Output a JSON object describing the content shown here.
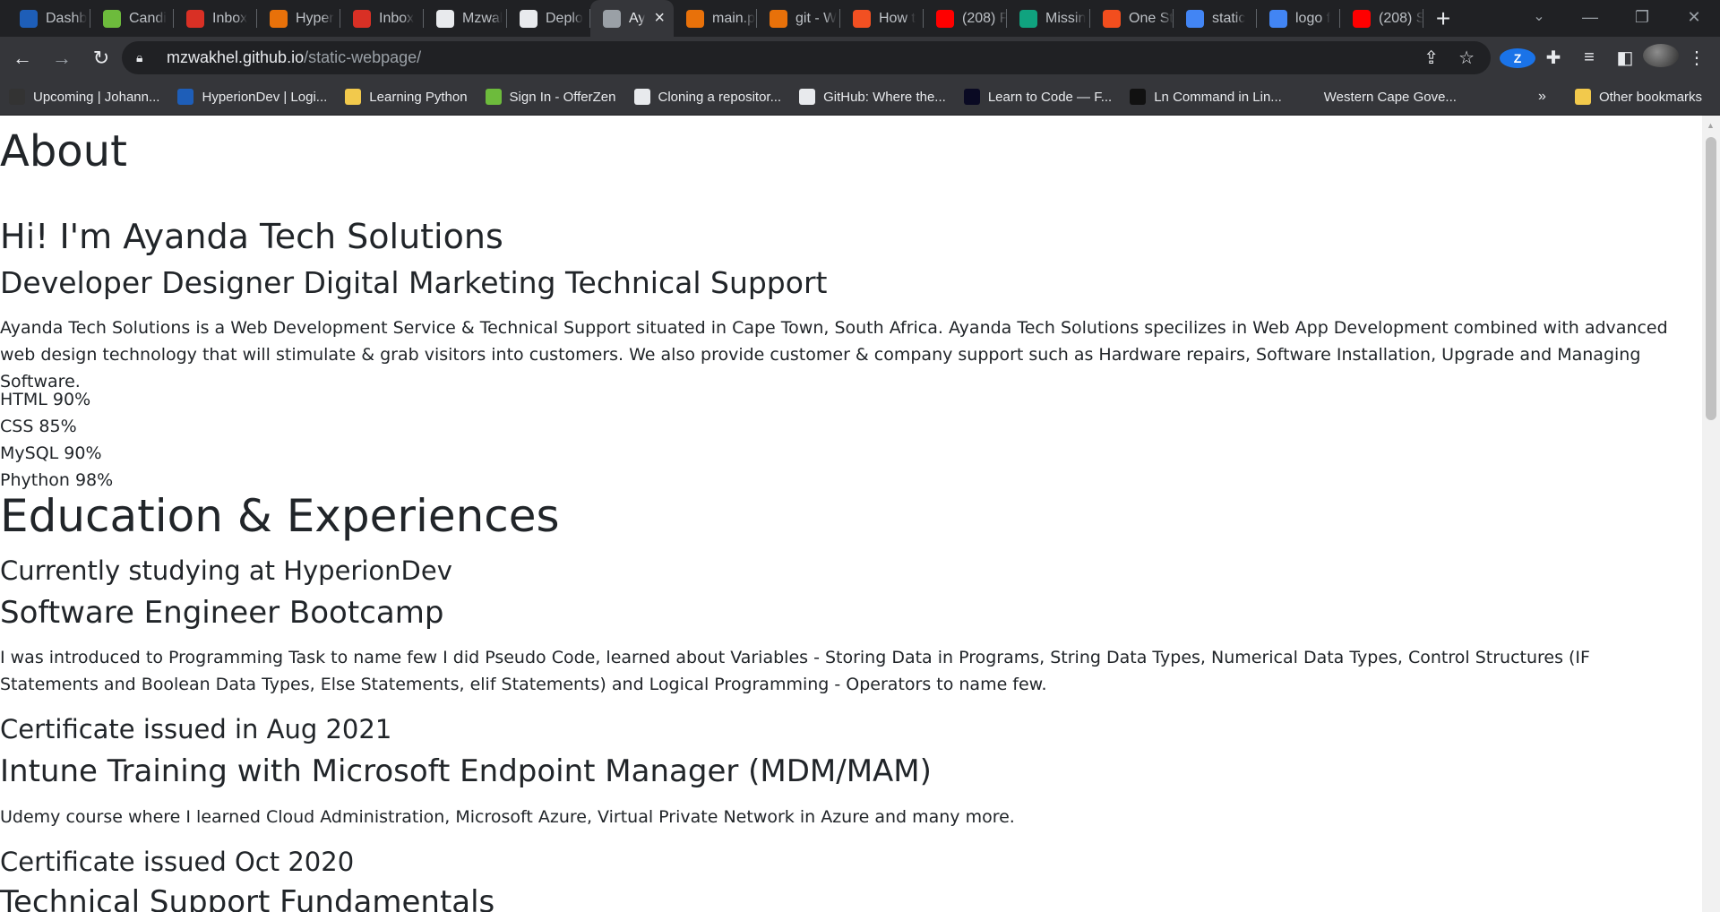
{
  "browser": {
    "tabs": [
      {
        "title": "Dashb",
        "icon": "hyperiondev-icon",
        "color": "#1e5eb8"
      },
      {
        "title": "Candi",
        "icon": "offerzen-icon",
        "color": "#6dbb3c"
      },
      {
        "title": "Inbox",
        "icon": "gmail-icon",
        "color": "#d93025"
      },
      {
        "title": "Hyper",
        "icon": "person-icon",
        "color": "#e8710a"
      },
      {
        "title": "Inbox",
        "icon": "gmail-icon",
        "color": "#d93025"
      },
      {
        "title": "Mzwal",
        "icon": "github-icon",
        "color": "#e8eaed"
      },
      {
        "title": "Deplo",
        "icon": "github-icon",
        "color": "#e8eaed"
      },
      {
        "title": "Ay",
        "icon": "globe-icon",
        "color": "#9aa0a6",
        "active": true
      },
      {
        "title": "main.p",
        "icon": "code-icon",
        "color": "#e8710a"
      },
      {
        "title": "git - W",
        "icon": "git-icon",
        "color": "#e8710a"
      },
      {
        "title": "How t",
        "icon": "microsoft-icon",
        "color": "#f25022"
      },
      {
        "title": "(208) F",
        "icon": "youtube-icon",
        "color": "#ff0000"
      },
      {
        "title": "Missin",
        "icon": "chatgpt-icon",
        "color": "#10a37f"
      },
      {
        "title": "One St",
        "icon": "figma-icon",
        "color": "#f24e1e"
      },
      {
        "title": "static",
        "icon": "google-icon",
        "color": "#4285f4"
      },
      {
        "title": "logo f",
        "icon": "google-icon",
        "color": "#4285f4"
      },
      {
        "title": "(208) S",
        "icon": "youtube-icon",
        "color": "#ff0000"
      }
    ],
    "new_tab": "+",
    "address": {
      "host": "mzwakhel.github.io",
      "path": "/static-webpage/"
    },
    "bookmarks": [
      {
        "label": "Upcoming | Johann...",
        "icon": "alx-icon",
        "color": "#333"
      },
      {
        "label": "HyperionDev | Logi...",
        "icon": "hyperiondev-icon",
        "color": "#1e5eb8"
      },
      {
        "label": "Learning Python",
        "icon": "folder-icon",
        "color": "#f2c94c"
      },
      {
        "label": "Sign In - OfferZen",
        "icon": "offerzen-icon",
        "color": "#6dbb3c"
      },
      {
        "label": "Cloning a repositor...",
        "icon": "github-icon",
        "color": "#e8eaed"
      },
      {
        "label": "GitHub: Where the...",
        "icon": "github-icon",
        "color": "#e8eaed"
      },
      {
        "label": "Learn to Code — F...",
        "icon": "freecodecamp-icon",
        "color": "#0a0a23"
      },
      {
        "label": "Ln Command in Lin...",
        "icon": "linux-icon",
        "color": "#111"
      },
      {
        "label": "Western Cape Gove...",
        "icon": "none",
        "color": "#35363a"
      }
    ],
    "bookmarks_more": "»",
    "other_bookmarks": "Other bookmarks"
  },
  "page": {
    "about_heading": "About",
    "intro_heading": "Hi! I'm Ayanda Tech Solutions",
    "roles": "Developer Designer Digital Marketing Technical Support",
    "intro_paragraph": "Ayanda Tech Solutions is a Web Development Service & Technical Support situated in Cape Town, South Africa. Ayanda Tech Solutions specilizes in Web App Development combined with advanced web design technology that will stimulate & grab visitors into customers. We also provide customer & company support such as Hardware repairs, Software Installation, Upgrade and Managing Software.",
    "skills": [
      "HTML 90%",
      "CSS 85%",
      "MySQL 90%",
      "Phython 98%"
    ],
    "education_heading": "Education & Experiences",
    "entries": [
      {
        "status": "Currently studying at HyperionDev",
        "title": "Software Engineer Bootcamp",
        "description": "I was introduced to Programming Task to name few I did Pseudo Code, learned about Variables - Storing Data in Programs, String Data Types, Numerical Data Types, Control Structures (IF Statements and Boolean Data Types, Else Statements, elif Statements) and Logical Programming - Operators to name few."
      },
      {
        "status": "Certificate issued in Aug 2021",
        "title": "Intune Training with Microsoft Endpoint Manager (MDM/MAM)",
        "description": "Udemy course where I learned Cloud Administration, Microsoft Azure, Virtual Private Network in Azure and many more."
      },
      {
        "status": "Certificate issued Oct 2020",
        "title": "Technical Support Fundamentals"
      }
    ]
  }
}
